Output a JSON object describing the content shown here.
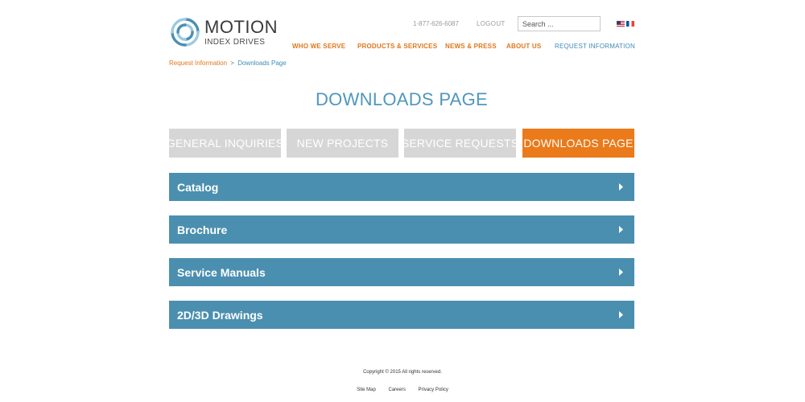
{
  "logo": {
    "line1": "MOTION",
    "line2": "INDEX DRIVES"
  },
  "header": {
    "phone": "1-877-626-6087",
    "logout_label": "LOGOUT",
    "search_placeholder": "Search ...",
    "flags": [
      "us-flag",
      "fr-flag"
    ]
  },
  "nav": {
    "items": [
      {
        "label": "WHO WE SERVE"
      },
      {
        "label": "PRODUCTS & SERVICES"
      },
      {
        "label": "NEWS & PRESS"
      },
      {
        "label": "ABOUT US"
      },
      {
        "label": "REQUEST INFORMATION",
        "active": true
      }
    ]
  },
  "breadcrumb": {
    "parent": "Request Information",
    "separator": ">",
    "current": "Downloads Page"
  },
  "page_title": "DOWNLOADS PAGE",
  "tabs": [
    {
      "label": "GENERAL INQUIRIES",
      "active": false
    },
    {
      "label": "NEW PROJECTS",
      "active": false
    },
    {
      "label": "SERVICE REQUESTS",
      "active": false
    },
    {
      "label": "DOWNLOADS PAGE",
      "active": true
    }
  ],
  "sections": [
    {
      "label": "Catalog",
      "icon": "chevron-right-icon"
    },
    {
      "label": "Brochure",
      "icon": "chevron-right-icon"
    },
    {
      "label": "Service Manuals",
      "icon": "chevron-right-icon"
    },
    {
      "label": "2D/3D Drawings",
      "icon": "chevron-right-icon"
    }
  ],
  "footer": {
    "copyright": "Copyright © 2015 All rights reserved.",
    "links": [
      "Site Map",
      "Careers",
      "Privacy Policy"
    ]
  },
  "colors": {
    "accent_orange": "#ea7a1a",
    "accent_blue": "#4b8fb0",
    "title_blue": "#4f97bd",
    "inactive_tab": "#d6d6d6"
  }
}
